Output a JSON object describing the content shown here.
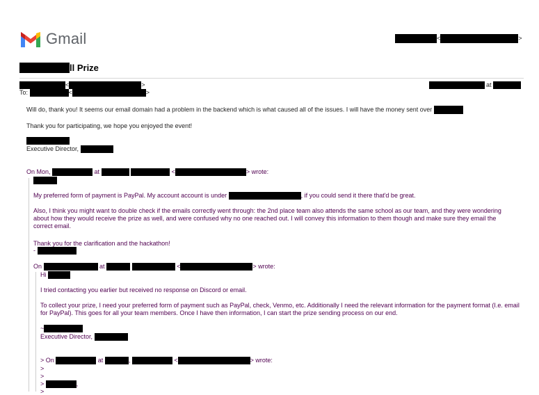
{
  "app": {
    "name": "Gmail"
  },
  "header": {
    "addr_open": "<",
    "addr_close": ">"
  },
  "subject": {
    "visible_suffix": "ll Prize"
  },
  "from_line": {
    "lt": "<",
    "gt": ">",
    "at": "at"
  },
  "to_line": {
    "label": "To:",
    "lt": "<",
    "gt": ">"
  },
  "reply": {
    "line1": "Will do, thank you! It seems our email domain had a problem in the backend which is what caused all of the issues. I will have the money sent over",
    "line2": "Thank you for participating, we hope you enjoyed the event!",
    "signature_title": "Executive Director,"
  },
  "quote1": {
    "on": "On Mon,",
    "at": "at",
    "wrote": "> wrote:",
    "lt": "<",
    "payment_a": "My preferred form of payment is PayPal. My account account is under",
    "payment_b": ", if you could send it there that'd be great.",
    "double_check": "Also, I think you might want to double check if the emails correctly went through: the 2nd place team also attends the same school as our team, and they were wondering about how they would receive the prize as well, and were confused why no one reached out. I will convey this information to them though and make sure they email the correct email.",
    "thanks": "Thank you for the clarification and the hackathon!",
    "dash": "-"
  },
  "quote2": {
    "on": "On",
    "at": "at",
    "lt": "<",
    "wrote": "> wrote:",
    "hi": "Hi",
    "contact": "I tried contacting you earlier but received no response on Discord or email.",
    "collect": "To collect your prize, I need your preferred form of payment such as PayPal, check, Venmo, etc. Additionally I need the relevant information for the payment format (I.e. email for PayPal). This goes for all your team members. Once I have then information, I can start the prize sending process on our end.",
    "tilde": "~",
    "signature_title": "Executive Director,"
  },
  "quote3": {
    "on": "> On",
    "at": "at",
    "comma": ",",
    "lt": "<",
    "wrote": "> wrote:",
    "gt1": ">",
    "gt2": ">",
    "gt3": ">",
    "trail": ",",
    "gt4": ">"
  },
  "colors": {
    "quoted_text": "#500050",
    "body_text": "#222222",
    "redaction": "#000000",
    "gmail_red": "#EA4335",
    "gmail_blue": "#4285F4",
    "gmail_green": "#34A853",
    "gmail_yellow": "#FBBC04"
  },
  "icons": {
    "logo": "gmail-m-icon"
  }
}
